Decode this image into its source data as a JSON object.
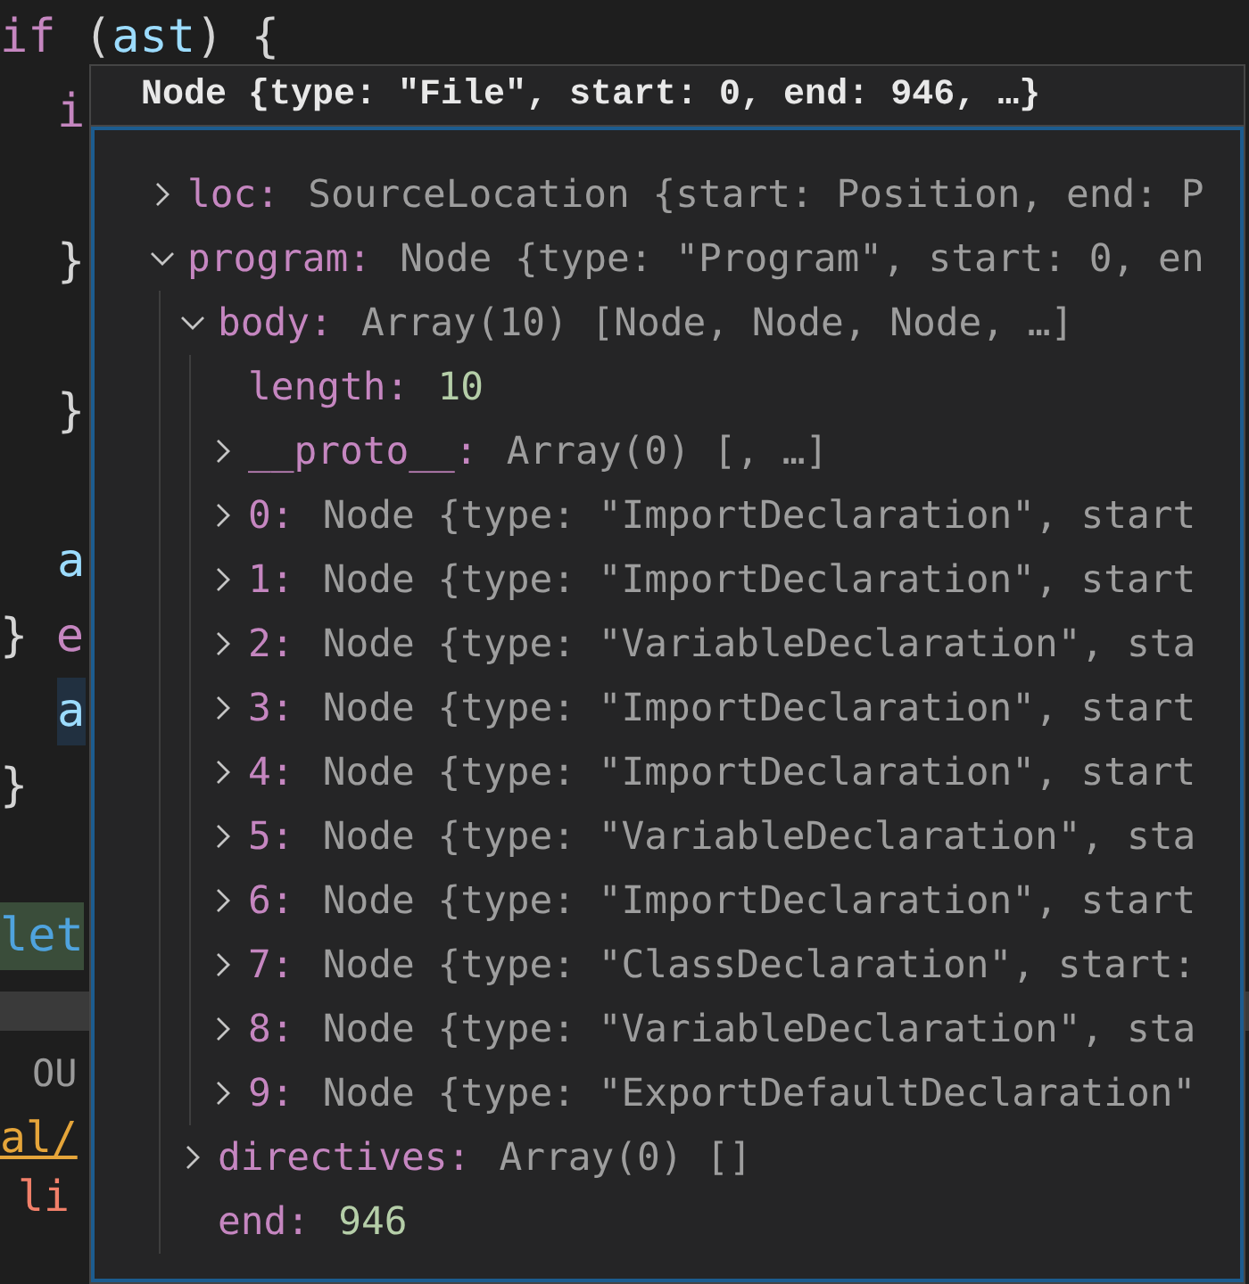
{
  "editor": {
    "lines": [
      {
        "tokens": [
          {
            "text": "if",
            "kind": "keyword"
          },
          {
            "text": " (",
            "kind": "punct"
          },
          {
            "text": "ast",
            "kind": "variable"
          },
          {
            "text": ") {",
            "kind": "punct"
          }
        ],
        "selected": false,
        "search_match": false,
        "children": [
          {
            "tokens": [
              {
                "text": "i",
                "kind": "keyword"
              }
            ],
            "selected": false,
            "search_match": false
          },
          {
            "tokens": [
              {
                "text": "}",
                "kind": "punct"
              }
            ],
            "selected": false,
            "search_match": false
          },
          {
            "tokens": [
              {
                "text": "}",
                "kind": "punct"
              }
            ],
            "selected": false,
            "search_match": false
          },
          {
            "tokens": [
              {
                "text": "a",
                "kind": "variable"
              }
            ],
            "selected": false,
            "search_match": false
          }
        ]
      },
      {
        "tokens": [
          {
            "text": "} ",
            "kind": "punct"
          },
          {
            "text": "e",
            "kind": "keyword"
          }
        ],
        "selected": false,
        "search_match": false,
        "children": [
          {
            "tokens": [
              {
                "text": "a",
                "kind": "variable"
              }
            ],
            "selected": true,
            "search_match": false
          }
        ]
      },
      {
        "tokens": [
          {
            "text": "}",
            "kind": "punct"
          }
        ],
        "selected": false,
        "search_match": false
      },
      {
        "tokens": [
          {
            "text": "let",
            "kind": "variable"
          }
        ],
        "selected": false,
        "search_match": true
      }
    ]
  },
  "panel": {
    "tab": "OU",
    "lines": [
      {
        "text": "al/",
        "kind": "link"
      },
      {
        "text": "li",
        "kind": "error"
      }
    ]
  },
  "hover": {
    "title": "Node {type: \"File\", start: 0, end: 946, …}",
    "tree": [
      {
        "key": "loc:",
        "value": "SourceLocation {start: Position, end: P",
        "kind": "object",
        "expanded": false
      },
      {
        "key": "program:",
        "value": "Node {type: \"Program\", start: 0, en",
        "kind": "object",
        "expanded": true,
        "children": [
          {
            "key": "body:",
            "value": "Array(10) [Node, Node, Node, …]",
            "kind": "object",
            "expanded": true,
            "children": [
              {
                "key": "length:",
                "value": "10",
                "kind": "number"
              },
              {
                "key": "__proto__:",
                "value": "Array(0) [, …]",
                "kind": "object",
                "expanded": false
              },
              {
                "key": "0:",
                "value": "Node {type: \"ImportDeclaration\", start",
                "kind": "object",
                "expanded": false
              },
              {
                "key": "1:",
                "value": "Node {type: \"ImportDeclaration\", start",
                "kind": "object",
                "expanded": false
              },
              {
                "key": "2:",
                "value": "Node {type: \"VariableDeclaration\", sta",
                "kind": "object",
                "expanded": false
              },
              {
                "key": "3:",
                "value": "Node {type: \"ImportDeclaration\", start",
                "kind": "object",
                "expanded": false
              },
              {
                "key": "4:",
                "value": "Node {type: \"ImportDeclaration\", start",
                "kind": "object",
                "expanded": false
              },
              {
                "key": "5:",
                "value": "Node {type: \"VariableDeclaration\", sta",
                "kind": "object",
                "expanded": false
              },
              {
                "key": "6:",
                "value": "Node {type: \"ImportDeclaration\", start",
                "kind": "object",
                "expanded": false
              },
              {
                "key": "7:",
                "value": "Node {type: \"ClassDeclaration\", start:",
                "kind": "object",
                "expanded": false
              },
              {
                "key": "8:",
                "value": "Node {type: \"VariableDeclaration\", sta",
                "kind": "object",
                "expanded": false
              },
              {
                "key": "9:",
                "value": "Node {type: \"ExportDefaultDeclaration\"",
                "kind": "object",
                "expanded": false
              }
            ]
          },
          {
            "key": "directives:",
            "value": "Array(0) []",
            "kind": "object",
            "expanded": false
          },
          {
            "key": "end:",
            "value": "946",
            "kind": "number"
          }
        ]
      }
    ]
  }
}
